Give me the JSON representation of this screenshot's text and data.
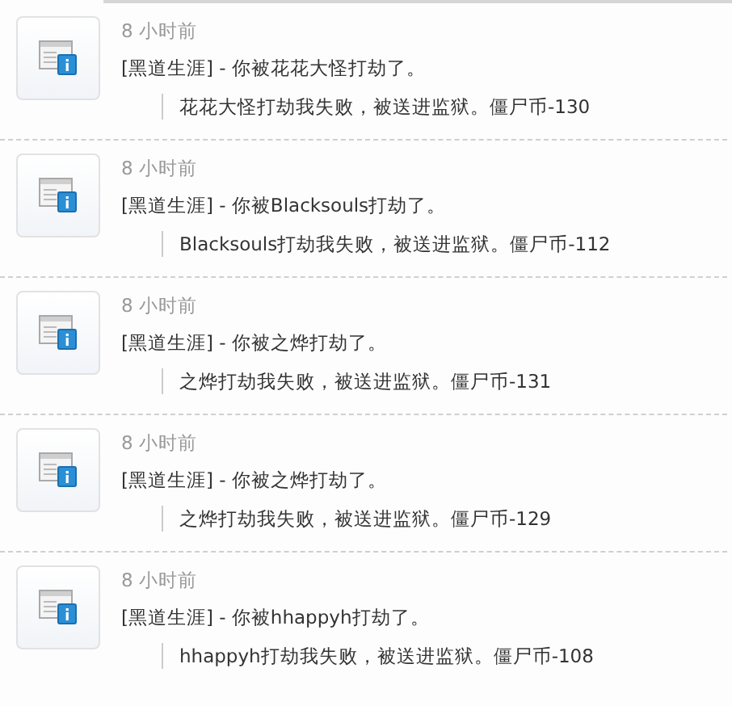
{
  "feed": [
    {
      "time": "8 小时前",
      "title": "[黑道生涯] - 你被花花大怪打劫了。",
      "detail": "花花大怪打劫我失败，被送进监狱。僵尸币-130"
    },
    {
      "time": "8 小时前",
      "title": "[黑道生涯] - 你被Blacksouls打劫了。",
      "detail": "Blacksouls打劫我失败，被送进监狱。僵尸币-112"
    },
    {
      "time": "8 小时前",
      "title": "[黑道生涯] - 你被之烨打劫了。",
      "detail": "之烨打劫我失败，被送进监狱。僵尸币-131"
    },
    {
      "time": "8 小时前",
      "title": "[黑道生涯] - 你被之烨打劫了。",
      "detail": "之烨打劫我失败，被送进监狱。僵尸币-129"
    },
    {
      "time": "8 小时前",
      "title": "[黑道生涯] - 你被hhappyh打劫了。",
      "detail": "hhappyh打劫我失败，被送进监狱。僵尸币-108"
    }
  ]
}
